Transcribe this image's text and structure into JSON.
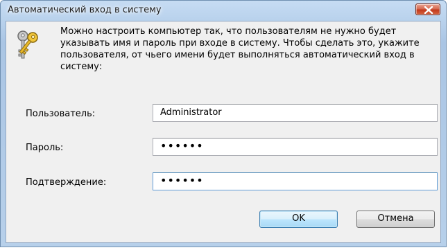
{
  "window": {
    "title": "Автоматический вход в систему"
  },
  "description": "Можно настроить компьютер так, что пользователям не нужно будет указывать имя и пароль при входе в систему. Чтобы сделать это, укажите пользователя, от чьего имени будет выполняться автоматический вход в систему:",
  "fields": {
    "user": {
      "label": "Пользователь:",
      "value": "Administrator"
    },
    "password": {
      "label": "Пароль:",
      "value": "••••••"
    },
    "confirm": {
      "label": "Подтверждение:",
      "value": "••••••"
    }
  },
  "buttons": {
    "ok": "OK",
    "cancel": "Отмена"
  },
  "icons": {
    "window_close": "close-icon",
    "header": "keys-icon"
  },
  "colors": {
    "titlebar": "#b8d1ec",
    "close_button": "#c2391d",
    "client_background": "#f0f0f0",
    "focus_border": "#5f9bd6"
  }
}
